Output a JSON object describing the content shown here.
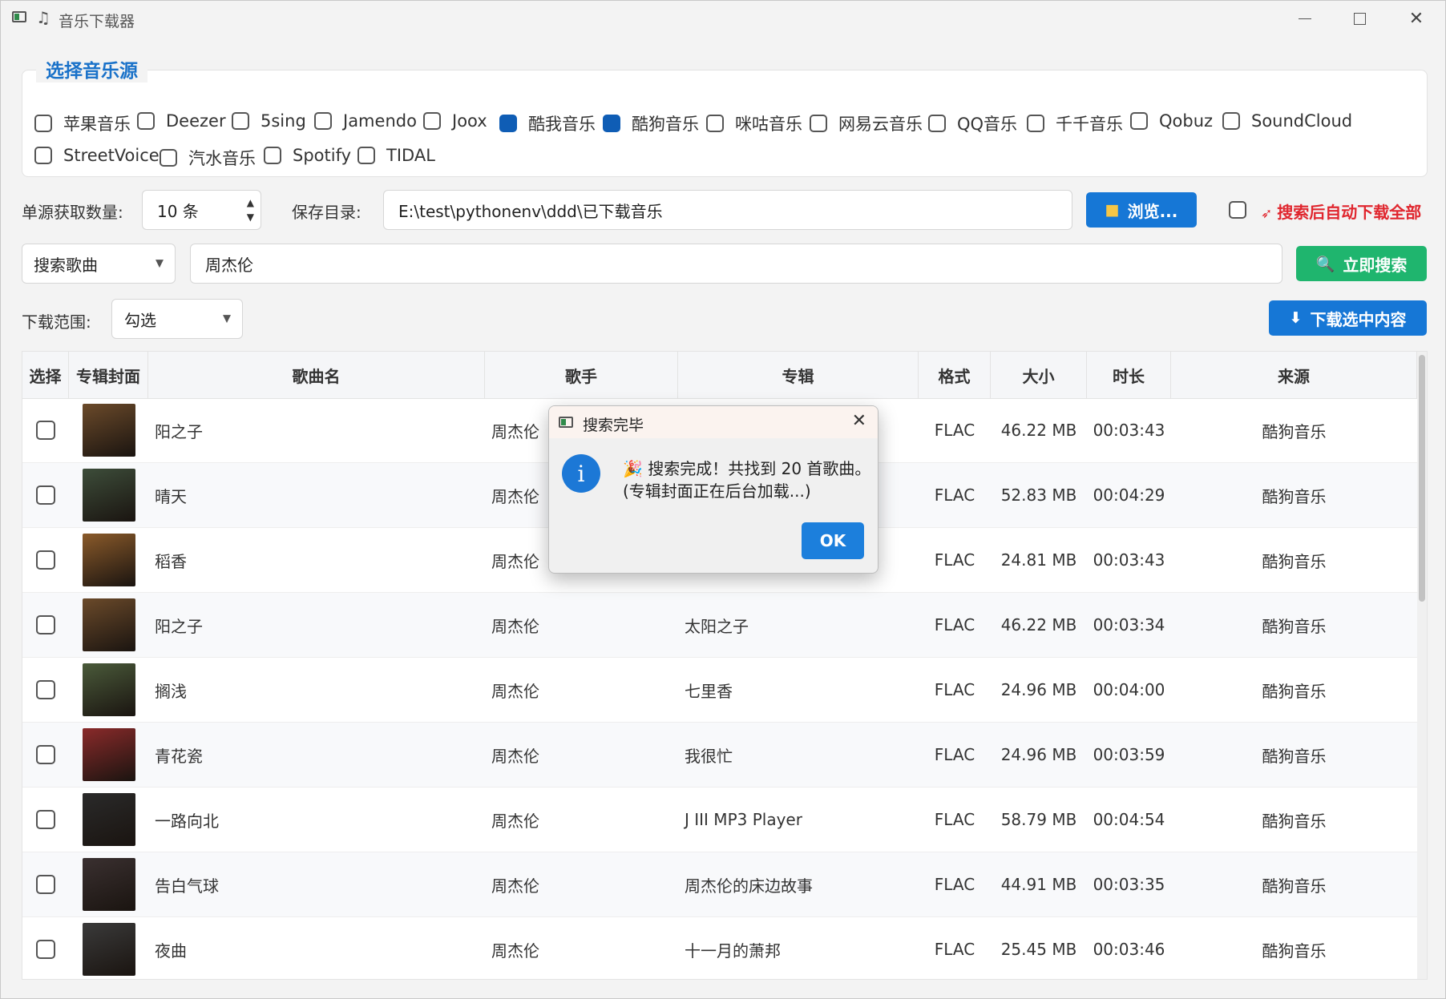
{
  "window": {
    "title": "音乐下载器",
    "note_glyph": "♫"
  },
  "sources": {
    "group_title": "选择音乐源",
    "items": [
      {
        "label": "苹果音乐",
        "checked": false
      },
      {
        "label": "Deezer",
        "checked": false
      },
      {
        "label": "5sing",
        "checked": false
      },
      {
        "label": "Jamendo",
        "checked": false
      },
      {
        "label": "Joox",
        "checked": false
      },
      {
        "label": "酷我音乐",
        "checked": true
      },
      {
        "label": "酷狗音乐",
        "checked": true
      },
      {
        "label": "咪咕音乐",
        "checked": false
      },
      {
        "label": "网易云音乐",
        "checked": false
      },
      {
        "label": "QQ音乐",
        "checked": false
      },
      {
        "label": "千千音乐",
        "checked": false
      },
      {
        "label": "Qobuz",
        "checked": false
      },
      {
        "label": "SoundCloud",
        "checked": false
      },
      {
        "label": "StreetVoice",
        "checked": false
      },
      {
        "label": "汽水音乐",
        "checked": false
      },
      {
        "label": "Spotify",
        "checked": false
      },
      {
        "label": "TIDAL",
        "checked": false
      }
    ]
  },
  "settings": {
    "count_label": "单源获取数量:",
    "count_value": "10 条",
    "dir_label": "保存目录:",
    "dir_value": "E:\\test\\pythonenv\\ddd\\已下载音乐",
    "browse_label": "浏览...",
    "auto_download_label": "搜索后自动下载全部",
    "auto_download_checked": false
  },
  "search": {
    "type_value": "搜索歌曲",
    "query_value": "周杰伦",
    "search_button": "立即搜索"
  },
  "range": {
    "label": "下载范围:",
    "value": "勾选",
    "download_button": "下载选中内容"
  },
  "table": {
    "headers": [
      "选择",
      "专辑封面",
      "歌曲名",
      "歌手",
      "专辑",
      "格式",
      "大小",
      "时长",
      "来源"
    ],
    "rows": [
      {
        "song": "阳之子",
        "artist": "周杰伦",
        "album": "",
        "format": "FLAC",
        "size": "46.22 MB",
        "duration": "00:03:43",
        "source": "酷狗音乐",
        "cover_color": "#6b4a2a"
      },
      {
        "song": "晴天",
        "artist": "周杰伦",
        "album": "",
        "format": "FLAC",
        "size": "52.83 MB",
        "duration": "00:04:29",
        "source": "酷狗音乐",
        "cover_color": "#3d4d3a"
      },
      {
        "song": "稻香",
        "artist": "周杰伦",
        "album": "",
        "format": "FLAC",
        "size": "24.81 MB",
        "duration": "00:03:43",
        "source": "酷狗音乐",
        "cover_color": "#8a5a2a"
      },
      {
        "song": "阳之子",
        "artist": "周杰伦",
        "album": "太阳之子",
        "format": "FLAC",
        "size": "46.22 MB",
        "duration": "00:03:34",
        "source": "酷狗音乐",
        "cover_color": "#6b4a2a"
      },
      {
        "song": "搁浅",
        "artist": "周杰伦",
        "album": "七里香",
        "format": "FLAC",
        "size": "24.96 MB",
        "duration": "00:04:00",
        "source": "酷狗音乐",
        "cover_color": "#4a5a3a"
      },
      {
        "song": "青花瓷",
        "artist": "周杰伦",
        "album": "我很忙",
        "format": "FLAC",
        "size": "24.96 MB",
        "duration": "00:03:59",
        "source": "酷狗音乐",
        "cover_color": "#8a2a2a"
      },
      {
        "song": "一路向北",
        "artist": "周杰伦",
        "album": "J III MP3 Player",
        "format": "FLAC",
        "size": "58.79 MB",
        "duration": "00:04:54",
        "source": "酷狗音乐",
        "cover_color": "#2a2a2a"
      },
      {
        "song": "告白气球",
        "artist": "周杰伦",
        "album": "周杰伦的床边故事",
        "format": "FLAC",
        "size": "44.91 MB",
        "duration": "00:03:35",
        "source": "酷狗音乐",
        "cover_color": "#3a3030"
      },
      {
        "song": "夜曲",
        "artist": "周杰伦",
        "album": "十一月的萧邦",
        "format": "FLAC",
        "size": "25.45 MB",
        "duration": "00:03:46",
        "source": "酷狗音乐",
        "cover_color": "#3a3a3a"
      }
    ]
  },
  "dialog": {
    "title": "搜索完毕",
    "message_line1": "🎉 搜索完成！共找到 20 首歌曲。",
    "message_line2": "(专辑封面正在后台加载...)",
    "ok_label": "OK"
  },
  "colors": {
    "accent": "#1677d6",
    "search_green": "#1fb56e",
    "warning_red": "#e0262e",
    "checked": "#0f5db5"
  }
}
